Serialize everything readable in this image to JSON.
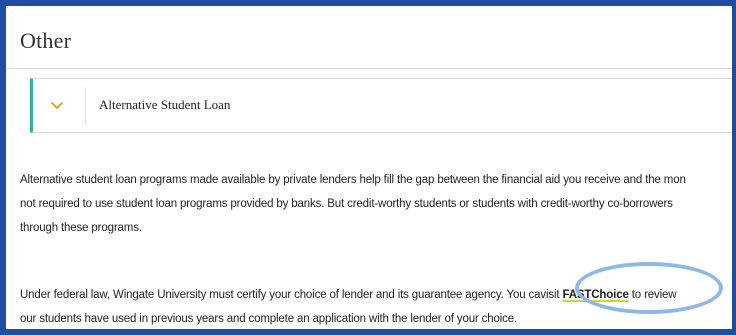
{
  "section": {
    "title": "Other"
  },
  "accordion": {
    "icon": "chevron-down-icon",
    "label": "Alternative Student Loan",
    "accent_color": "#2cb6a2",
    "icon_color": "#d9a43a"
  },
  "content": {
    "paragraph1": [
      "Alternative student loan programs made available by private lenders help fill the gap between the financial aid you receive and the mon",
      "not required to use student loan programs provided by banks. But credit-worthy students or students with credit-worthy co-borrowers",
      "through these programs."
    ],
    "paragraph2": {
      "line1_before": "Under federal law, Wingate University must certify your choice of lender and its guarantee agency. You ca",
      "line1_visit": "visit ",
      "link_text": "FASTChoice",
      "line1_after": " to review",
      "line2": "our students have used in previous years and complete an application with the lender of your choice."
    }
  },
  "colors": {
    "frame_border": "#1f4da0",
    "highlight_ellipse": "#8fb8e6",
    "link_underline": "#c8d63a"
  }
}
